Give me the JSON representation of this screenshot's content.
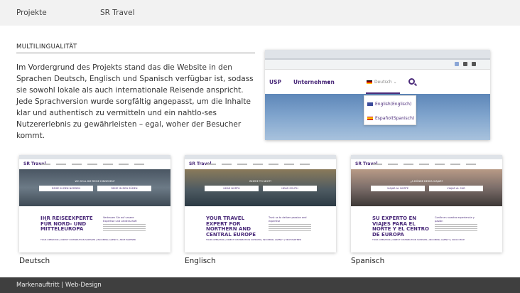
{
  "header": {
    "breadcrumb_1": "Projekte",
    "breadcrumb_2": "SR Travel"
  },
  "section": {
    "label": "MULTILINGUALITÄT",
    "body": "Im Vordergrund des Projekts stand das die Website in den Sprachen Deutsch, Englisch und Spanisch verfügbar ist, sodass sie sowohl lokale als auch internationale Reisende anspricht. Jede Sprachversion wurde sorgfältig angepasst, um die Inhalte klar und authentisch zu vermitteln und ein nahtlo-ses Nutzererlebnis zu gewährleisten – egal, woher der Besucher kommt."
  },
  "browser_mock": {
    "nav": {
      "usp": "USP",
      "unternehmen": "Unternehmen",
      "language": "Deutsch"
    },
    "dropdown": {
      "option_en": "English(Englisch)",
      "option_es": "Español(Spanisch)"
    }
  },
  "thumbnails": [
    {
      "caption": "Deutsch",
      "logo": "SR Travel",
      "hero_label": "WO SOLL DIE REISE HINGEHEN?",
      "button_1": "REISE IN DEN NORDEN",
      "button_2": "REISE IN DEN SÜDEN",
      "headline": "IHR REISEEXPERTE FÜR NORD- UND MITTELEUROPA",
      "subheadline": "Vertrauen Sie auf unsere Expertise und Leidenschaft",
      "footer": "TOUR OPERATOR | DIRECT DISTRIBUTION SUPPLIER | INCOMING AGENCY | MICE PARTNER"
    },
    {
      "caption": "Englisch",
      "logo": "SR Travel",
      "hero_label": "WHERE TO NEXT?",
      "button_1": "HEAD NORTH",
      "button_2": "HEAD SOUTH",
      "headline": "YOUR TRAVEL EXPERT FOR NORTHERN AND CENTRAL EUROPE",
      "subheadline": "Trust us to deliver passion and expertise",
      "footer": "TOUR OPERATOR | DIRECT DISTRIBUTION SUPPLIER | INCOMING AGENCY | MICE PARTNER"
    },
    {
      "caption": "Spanisch",
      "logo": "SR Travel",
      "hero_label": "¿A DÓNDE DESEA VIAJAR?",
      "button_1": "VIAJAR AL NORTE",
      "button_2": "VIAJAR AL SUR",
      "headline": "SU EXPERTO EN VIAJES PARA EL NORTE Y EL CENTRO DE EUROPA",
      "subheadline": "Confíe en nuestra experiencia y pasión",
      "footer": "TOUR OPERATOR | DIRECT DISTRIBUTION SUPPLIER | INCOMING AGENCY | SOCIO MICE"
    }
  ],
  "footer": {
    "text": "Markenauftritt | Web-Design"
  },
  "colors": {
    "accent": "#4b2b7a",
    "footer_bg": "#3f3f3f",
    "topbar_bg": "#f2f2f2"
  },
  "icons": [
    "search-icon",
    "chevron-down-icon",
    "flag-de-icon",
    "flag-en-icon",
    "flag-es-icon"
  ]
}
